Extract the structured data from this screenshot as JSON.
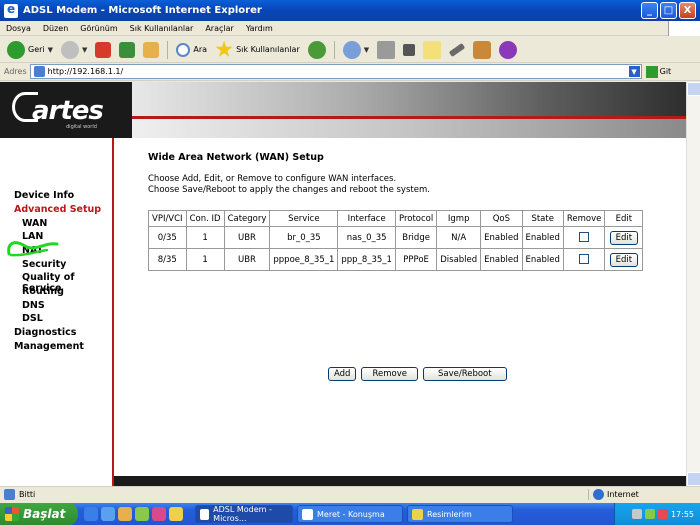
{
  "window": {
    "title": "ADSL Modem - Microsoft Internet Explorer",
    "minimize": "_",
    "maximize": "□",
    "close": "X"
  },
  "menu": [
    "Dosya",
    "Düzen",
    "Görünüm",
    "Sık Kullanılanlar",
    "Araçlar",
    "Yardım"
  ],
  "toolbar": {
    "back": "Geri",
    "search": "Ara",
    "favorites": "Sık Kullanılanlar"
  },
  "address": {
    "label": "Adres",
    "value": "http://192.168.1.1/",
    "go": "Git"
  },
  "brand": {
    "logo": "artes",
    "tagline": "digital world"
  },
  "nav": {
    "items": [
      {
        "label": "Device Info"
      },
      {
        "label": "Advanced Setup"
      },
      {
        "label": "WAN"
      },
      {
        "label": "LAN"
      },
      {
        "label": "NAT"
      },
      {
        "label": "Security"
      },
      {
        "label": "Quality of Service"
      },
      {
        "label": "Routing"
      },
      {
        "label": "DNS"
      },
      {
        "label": "DSL"
      },
      {
        "label": "Diagnostics"
      },
      {
        "label": "Management"
      }
    ]
  },
  "content": {
    "title": "Wide Area Network (WAN) Setup",
    "line1": "Choose Add, Edit, or Remove to configure WAN interfaces.",
    "line2": "Choose Save/Reboot to apply the changes and reboot the system."
  },
  "table": {
    "headers": [
      "VPI/VCI",
      "Con. ID",
      "Category",
      "Service",
      "Interface",
      "Protocol",
      "Igmp",
      "QoS",
      "State",
      "Remove",
      "Edit"
    ],
    "rows": [
      {
        "vpivci": "0/35",
        "conid": "1",
        "category": "UBR",
        "service": "br_0_35",
        "interface": "nas_0_35",
        "protocol": "Bridge",
        "igmp": "N/A",
        "qos": "Enabled",
        "state": "Enabled",
        "edit": "Edit"
      },
      {
        "vpivci": "8/35",
        "conid": "1",
        "category": "UBR",
        "service": "pppoe_8_35_1",
        "interface": "ppp_8_35_1",
        "protocol": "PPPoE",
        "igmp": "Disabled",
        "qos": "Enabled",
        "state": "Enabled",
        "edit": "Edit"
      }
    ]
  },
  "actions": {
    "add": "Add",
    "remove": "Remove",
    "save": "Save/Reboot"
  },
  "status": {
    "text": "Bitti",
    "zone": "Internet"
  },
  "taskbar": {
    "start": "Başlat",
    "tasks": [
      "ADSL Modem - Micros...",
      "Meret - Konuşma",
      "Resimlerim"
    ],
    "clock": "17:55"
  },
  "colors": {
    "accent": "#b81818",
    "annotation": "#22d822"
  }
}
